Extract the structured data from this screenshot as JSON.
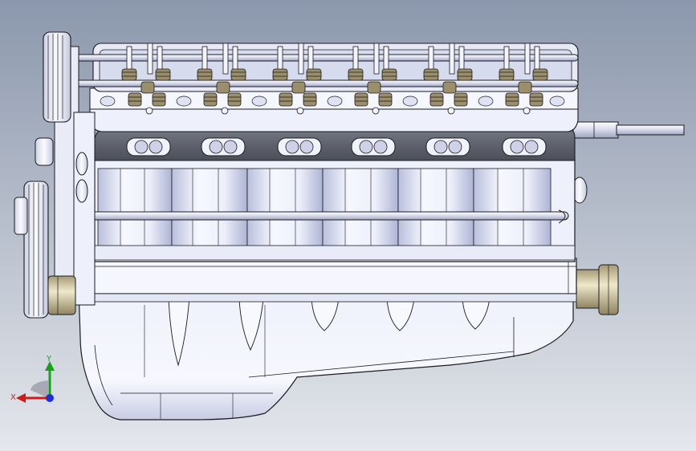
{
  "viewport": {
    "background_top": "#8b97ac",
    "background_bottom": "#dde1e8"
  },
  "model": {
    "body_color": "#f2f3fb",
    "shade_color": "#c8cde6",
    "dark_color": "#5a5d66",
    "brass_color": "#d9d0ad",
    "outline_color": "#1b1b22"
  },
  "triad": {
    "x_label": "X",
    "y_label": "Y",
    "x_color": "#d11a1a",
    "y_color": "#16a316",
    "z_color": "#1f2fd6"
  }
}
